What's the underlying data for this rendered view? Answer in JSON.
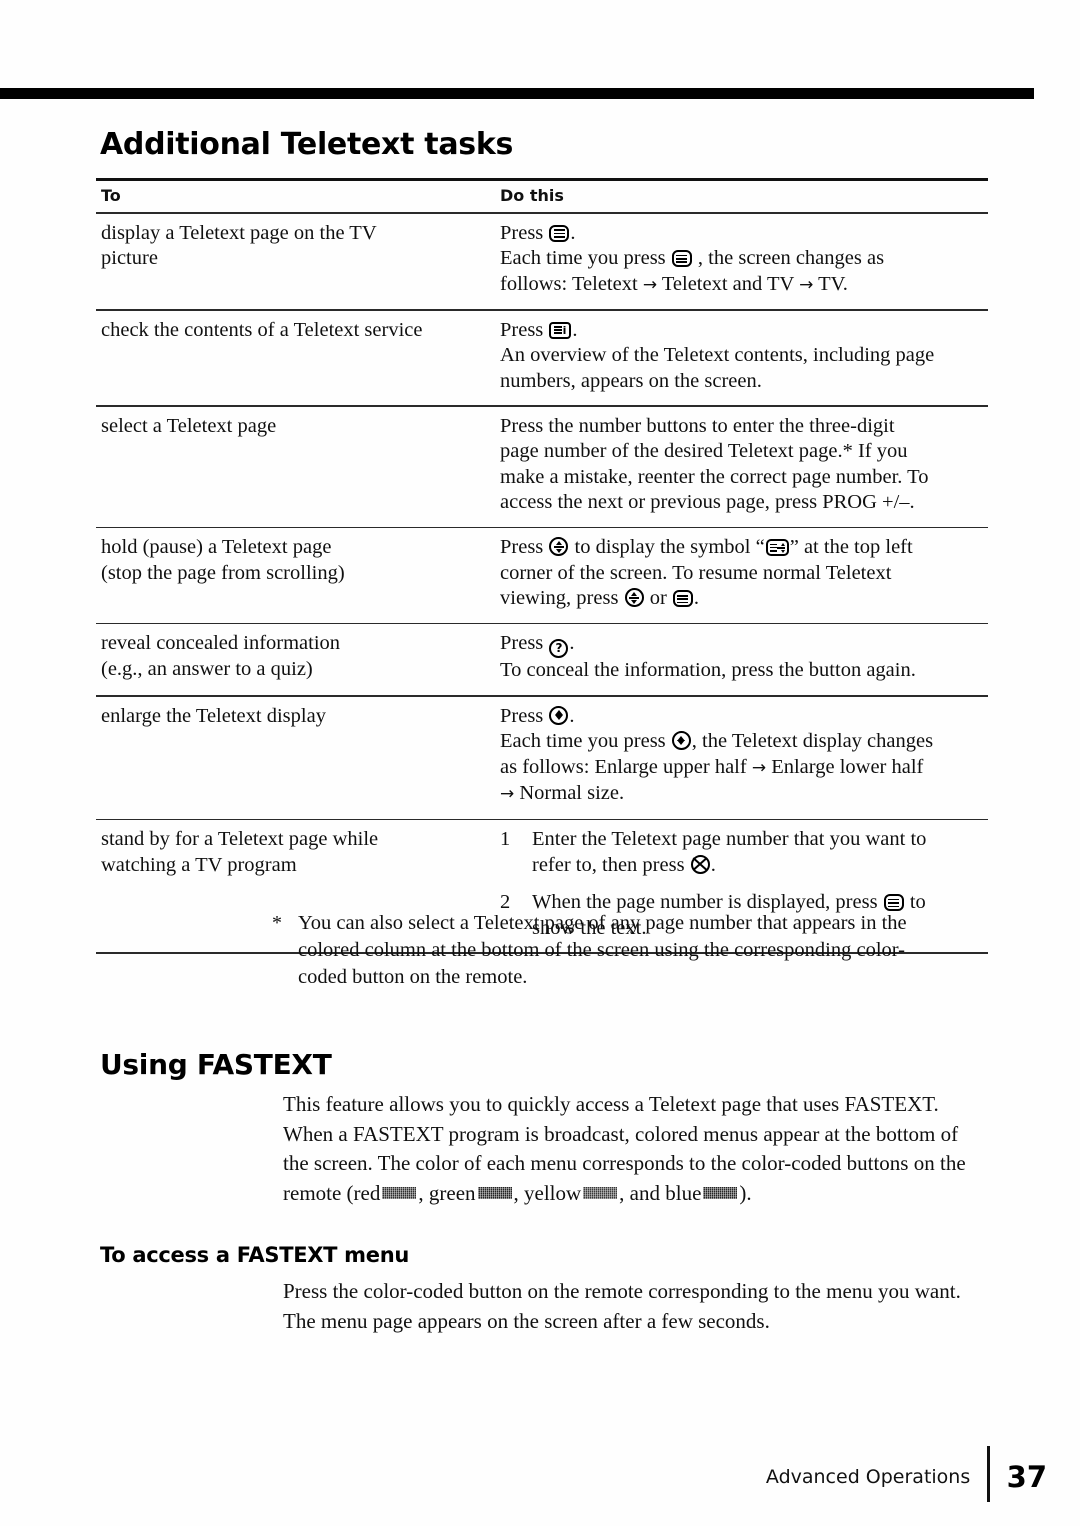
{
  "document": {
    "heading_main": "Additional Teletext tasks",
    "heading_fastext": "Using FASTEXT",
    "heading_fastext_menu": "To access a FASTEXT menu"
  },
  "table": {
    "header": {
      "col_to": "To",
      "col_do": "Do this"
    },
    "rows": [
      {
        "to_lines": [
          "display a Teletext page on the TV",
          "picture"
        ],
        "do_lines": [
          "Press [teletext-icon].",
          "Each time you press [teletext-icon] , the screen changes as",
          "follows: Teletext → Teletext and TV → TV."
        ]
      },
      {
        "to_lines": [
          "check the contents of a Teletext service"
        ],
        "do_lines": [
          "Press [teletext-info-icon].",
          "An overview of the Teletext contents, including page",
          "numbers, appears on the screen."
        ]
      },
      {
        "to_lines": [
          "select a Teletext page"
        ],
        "do_lines": [
          "Press the number buttons to enter the three-digit",
          "page number of the desired Teletext page.* If you",
          "make a mistake, reenter the correct page number. To",
          "access the next or previous page, press PROG +/–."
        ]
      },
      {
        "to_lines": [
          "hold (pause) a Teletext page",
          "(stop the page from scrolling)"
        ],
        "do_lines": [
          "Press [hold-icon] to display the symbol “[hold-symbol-icon]” at the top left",
          "corner of the screen. To resume normal Teletext",
          "viewing, press [hold-icon] or [teletext-icon]."
        ]
      },
      {
        "to_lines": [
          "reveal concealed information",
          "(e.g., an answer to a quiz)"
        ],
        "do_lines": [
          "Press [reveal-icon].",
          "To conceal the information, press the button again."
        ]
      },
      {
        "to_lines": [
          "enlarge the Teletext display"
        ],
        "do_lines": [
          "Press [enlarge-icon].",
          "Each time you press [enlarge-icon], the Teletext display changes",
          "as follows: Enlarge upper half → Enlarge lower half",
          "→ Normal size."
        ]
      },
      {
        "to_lines": [
          "stand by for a Teletext page while",
          "watching a TV program"
        ],
        "steps": [
          {
            "number": "1",
            "lines": [
              "Enter the Teletext page number that you want to",
              "refer to, then press [standby-icon]."
            ]
          },
          {
            "number": "2",
            "lines": [
              "When the page number is displayed, press [teletext-icon] to",
              "show the text."
            ]
          }
        ]
      }
    ]
  },
  "footnote": {
    "mark": "*",
    "lines": [
      "You can also select a Teletext page of any page number that appears in the",
      "colored column at the bottom of the screen using the corresponding color-",
      "coded button on the remote."
    ]
  },
  "fastext_paragraph": {
    "part1": "This feature allows you to quickly access a Teletext page that uses FASTEXT. When a FASTEXT program is broadcast, colored menus appear at the bottom of the screen. The color of each menu corresponds to the color-coded buttons on the remote (red",
    "sep_green": ", green",
    "sep_yellow": ", yellow",
    "sep_blue": ", and blue",
    "part_end": ")."
  },
  "fastext_menu_paragraph": {
    "text": "Press the color-coded button on the remote corresponding to the menu you want. The menu page appears on the screen after a few seconds."
  },
  "footer": {
    "section": "Advanced Operations",
    "page_number": "37"
  },
  "icons": {
    "teletext": "teletext-icon",
    "teletext_info": "teletext-info-icon",
    "hold": "hold-icon",
    "hold_symbol": "hold-symbol-icon",
    "reveal": "reveal-icon",
    "enlarge": "enlarge-icon",
    "standby": "standby-icon",
    "reveal_glyph": "?"
  },
  "colors": {
    "ink": "#101010",
    "rule": "#000000",
    "swatch_red": "#2e2e2e",
    "swatch_green": "#232323",
    "swatch_yellow": "#3a3a3a",
    "swatch_blue": "#242424"
  }
}
